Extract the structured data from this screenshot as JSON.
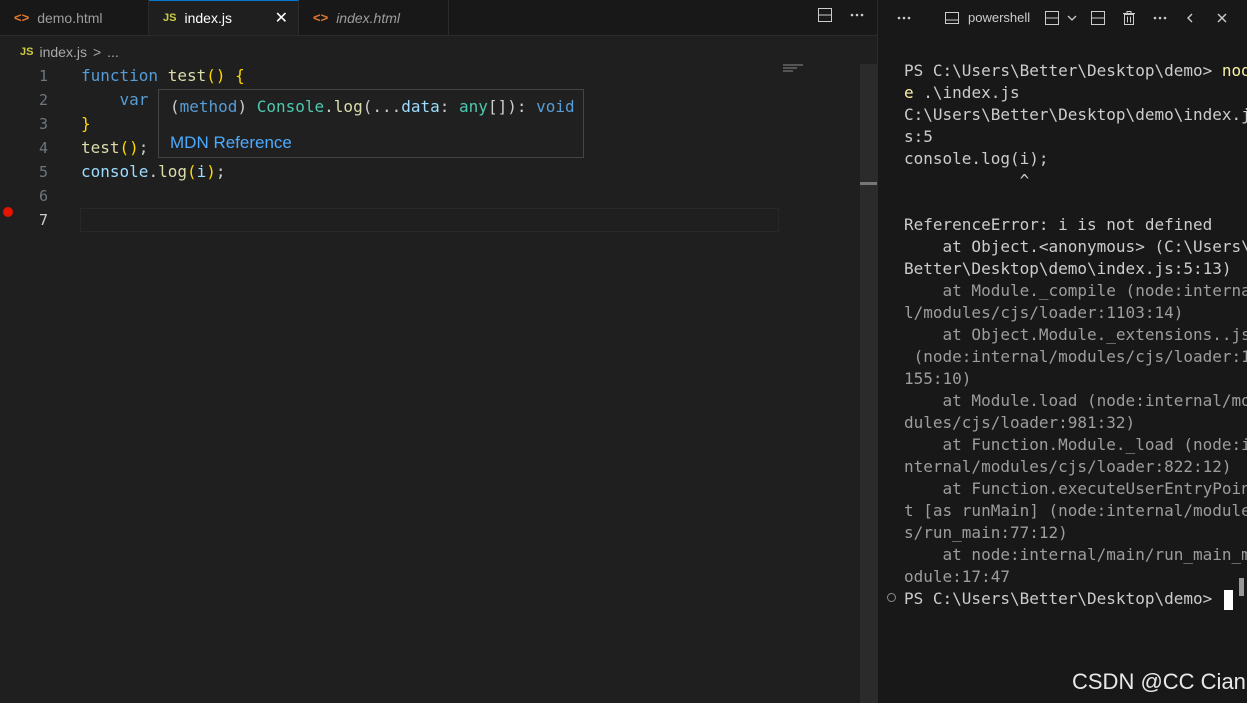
{
  "editor": {
    "tabs": [
      {
        "label": "demo.html",
        "icon": "html-icon"
      },
      {
        "label": "index.js",
        "icon": "js-icon",
        "close": "✕"
      },
      {
        "label": "index.html",
        "icon": "html-icon"
      }
    ],
    "tab_js_badge": "JS",
    "tab_html_badge": "<>",
    "breadcrumb": {
      "badge": "JS",
      "file": "index.js",
      "sep": ">",
      "more": "..."
    },
    "line_numbers": [
      "1",
      "2",
      "3",
      "4",
      "5",
      "6",
      "7"
    ],
    "code": {
      "l1_kw": "function",
      "l1_fn": "test",
      "l1_paren": "()",
      "l1_brace": "{",
      "l2_kw": "var",
      "l3_brace": "}",
      "l4_fn": "test",
      "l4_paren": "()",
      "l4_semi": ";",
      "l5_obj": "console",
      "l5_dot": ".",
      "l5_fn": "log",
      "l5_open": "(",
      "l5_arg": "i",
      "l5_close": ")",
      "l5_semi": ";"
    },
    "hover": {
      "p_open": "(",
      "kind": "method",
      "p_close": ")",
      "cls": "Console",
      "dot": ".",
      "method": "log",
      "args_open": "(...",
      "param": "data",
      "colon": ": ",
      "type": "any",
      "arr": "[]",
      "close": "): ",
      "ret": "void",
      "link": "MDN Reference"
    }
  },
  "terminal": {
    "shell_name": "powershell",
    "lines": [
      {
        "text": "PS C:\\Users\\Better\\Desktop\\demo> ",
        "yl": "nod"
      },
      {
        "text": "",
        "yl": "e",
        "rest": " .\\index.js"
      },
      {
        "text": "C:\\Users\\Better\\Desktop\\demo\\index.j"
      },
      {
        "text": "s:5"
      },
      {
        "text": "console.log(i);"
      },
      {
        "text": "            ^"
      },
      {
        "text": ""
      },
      {
        "text": "ReferenceError: i is not defined"
      },
      {
        "text": "    at Object.<anonymous> (C:\\Users\\"
      },
      {
        "text": "Better\\Desktop\\demo\\index.js:5:13)"
      },
      {
        "text": "    at Module._compile (node:interna",
        "dim": true
      },
      {
        "text": "l/modules/cjs/loader:1103:14)",
        "dim": true
      },
      {
        "text": "    at Object.Module._extensions..js",
        "dim": true
      },
      {
        "text": " (node:internal/modules/cjs/loader:1",
        "dim": true
      },
      {
        "text": "155:10)",
        "dim": true
      },
      {
        "text": "    at Module.load (node:internal/mo",
        "dim": true
      },
      {
        "text": "dules/cjs/loader:981:32)",
        "dim": true
      },
      {
        "text": "    at Function.Module._load (node:i",
        "dim": true
      },
      {
        "text": "nternal/modules/cjs/loader:822:12)",
        "dim": true
      },
      {
        "text": "    at Function.executeUserEntryPoin",
        "dim": true
      },
      {
        "text": "t [as runMain] (node:internal/module",
        "dim": true
      },
      {
        "text": "s/run_main:77:12)",
        "dim": true
      },
      {
        "text": "    at node:internal/main/run_main_m",
        "dim": true
      },
      {
        "text": "odule:17:47",
        "dim": true
      }
    ],
    "prompt": "PS C:\\Users\\Better\\Desktop\\demo> "
  },
  "watermark": "CSDN @CC Cian"
}
